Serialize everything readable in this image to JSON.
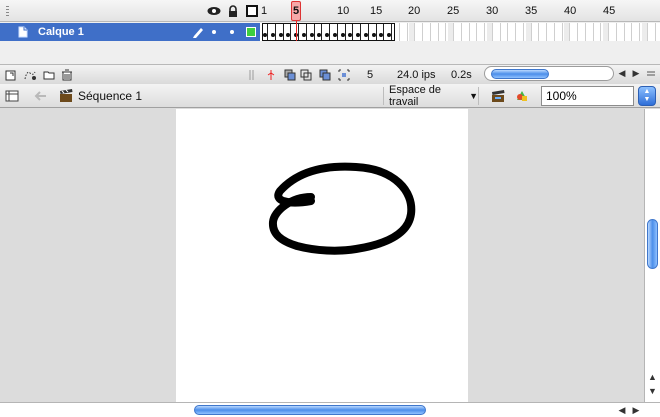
{
  "timeline": {
    "frame_numbers": [
      "1",
      "5",
      "10",
      "15",
      "20",
      "25",
      "30",
      "35",
      "40",
      "45"
    ],
    "current_frame_marker": "5",
    "layer": {
      "name": "Calque 1",
      "color": "#3ecf3e"
    },
    "footer": {
      "current_frame": "5",
      "frame_rate": "24.0 ips",
      "elapsed_time": "0.2s"
    }
  },
  "edit_bar": {
    "scene_label": "Séquence 1",
    "workspace_label": "Espace de travail",
    "zoom_value": "100%"
  },
  "colors": {
    "layer_selected_bg": "#3f6fc8",
    "playhead": "#e22222",
    "scroll_thumb": "#4b8eea",
    "stage_bg": "#ffffff",
    "stroke": "#000000"
  }
}
